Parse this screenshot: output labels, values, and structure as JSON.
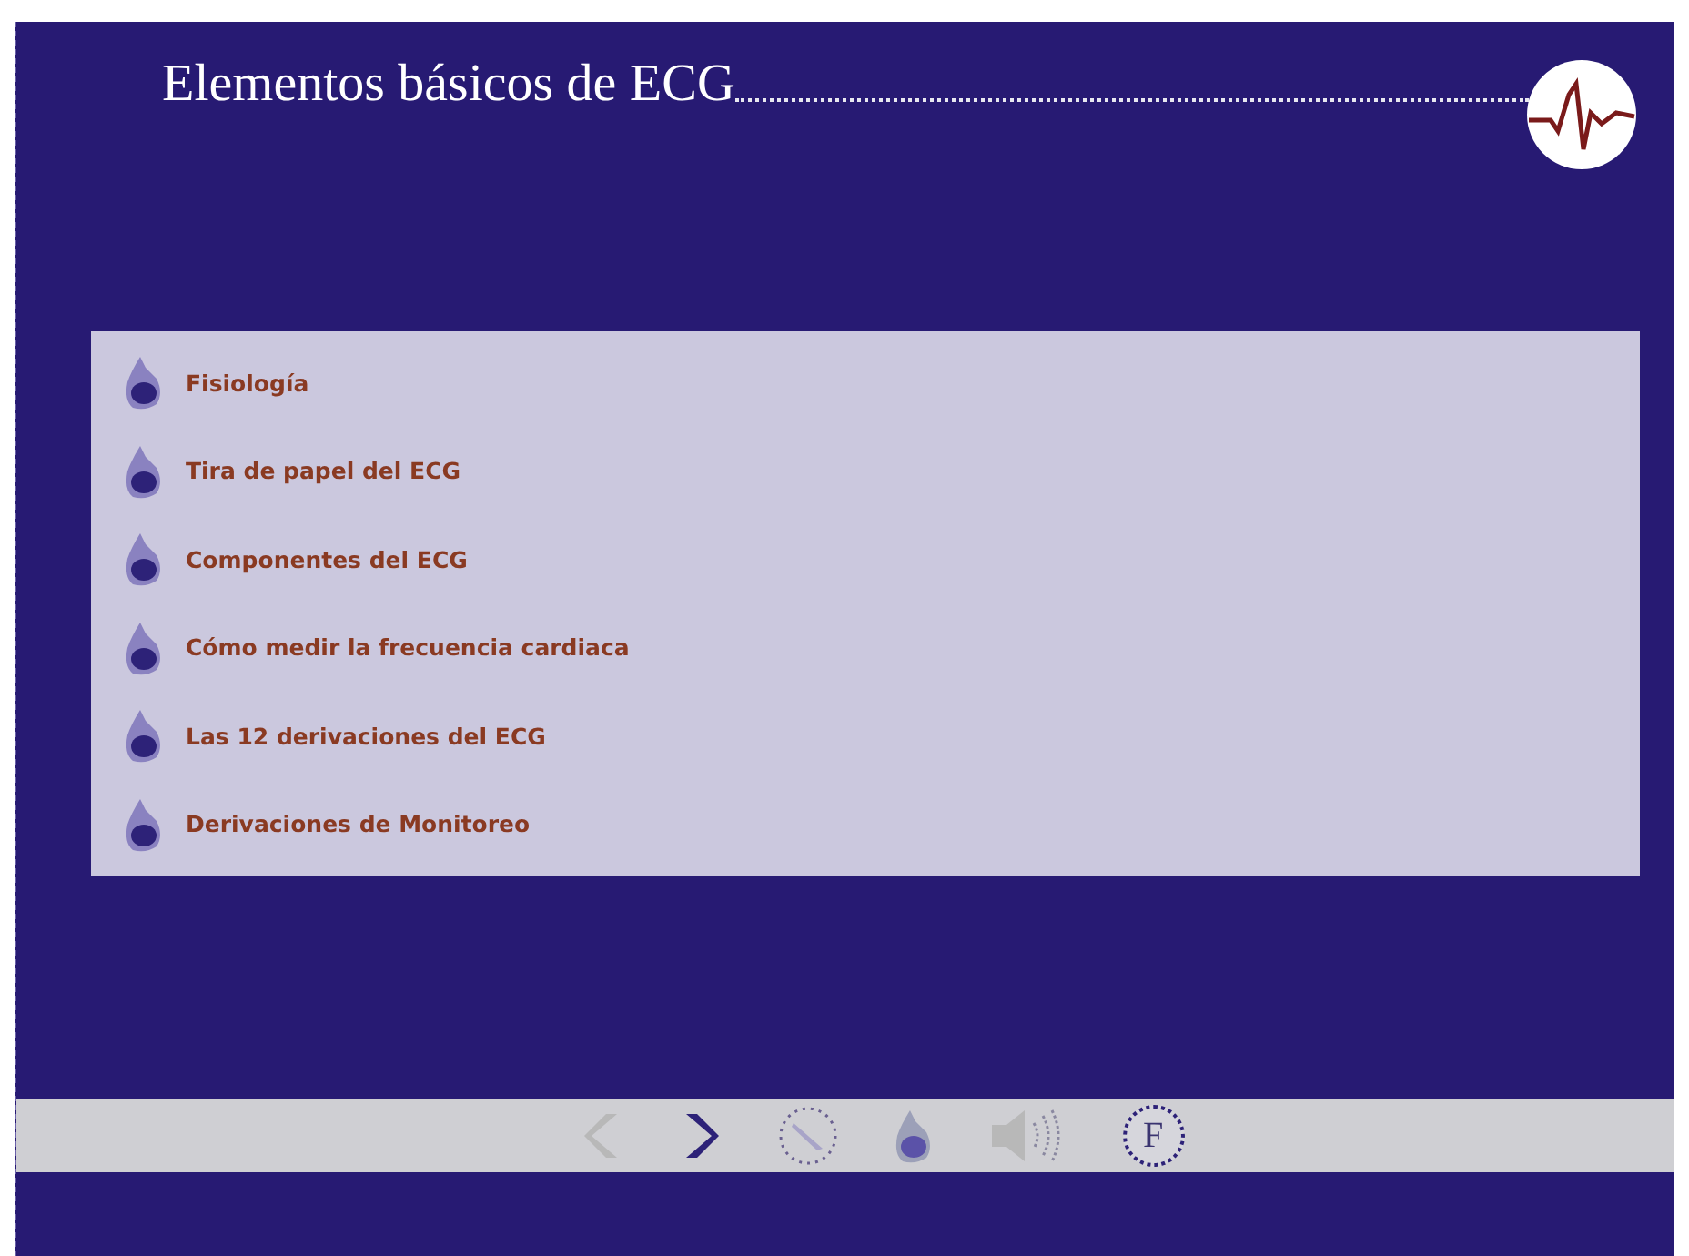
{
  "header": {
    "title": "Elementos básicos de ECG"
  },
  "menu": {
    "items": [
      {
        "label": "Fisiología"
      },
      {
        "label": "Tira de papel del ECG"
      },
      {
        "label": "Componentes del ECG"
      },
      {
        "label": "Cómo medir la frecuencia cardiaca"
      },
      {
        "label": "Las 12 derivaciones del ECG"
      },
      {
        "label": "Derivaciones de Monitoreo"
      }
    ]
  },
  "toolbar": {
    "back_disabled": true,
    "forward_disabled": false,
    "sound_disabled": true,
    "glossary_label": "F"
  }
}
